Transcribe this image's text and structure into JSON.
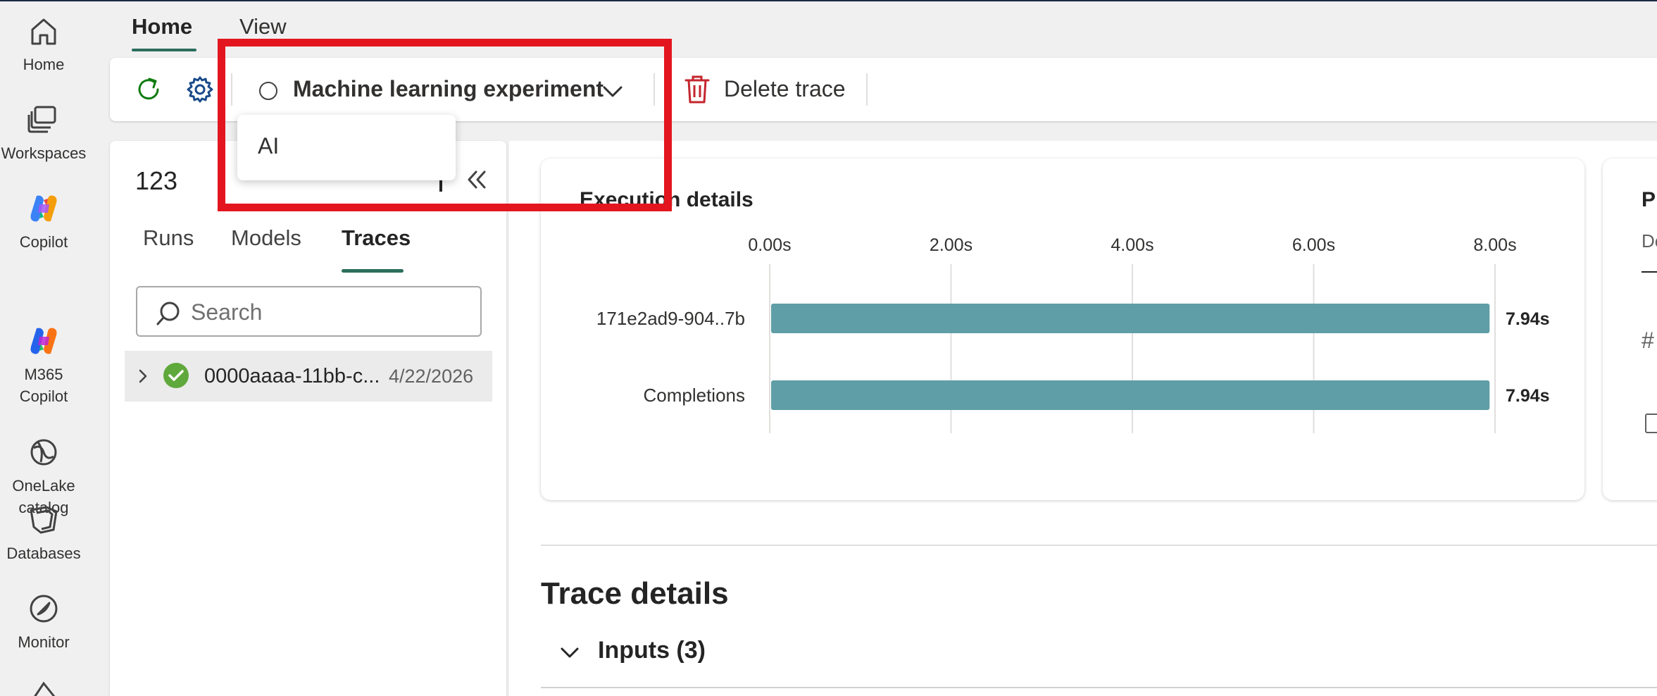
{
  "rail": {
    "items": [
      {
        "label": "Home",
        "icon": "home-icon"
      },
      {
        "label": "Workspaces",
        "icon": "workspaces-icon"
      },
      {
        "label": "Copilot",
        "icon": "copilot-icon"
      },
      {
        "label": "M365\nCopilot",
        "icon": "m365-copilot-icon"
      },
      {
        "label": "OneLake\ncatalog",
        "icon": "onelake-icon"
      },
      {
        "label": "Databases",
        "icon": "databases-icon"
      },
      {
        "label": "Monitor",
        "icon": "monitor-icon"
      }
    ]
  },
  "header": {
    "tabs": [
      {
        "label": "Home",
        "active": true
      },
      {
        "label": "View",
        "active": false
      }
    ]
  },
  "toolbar": {
    "experiment_label": "Machine learning experiment",
    "delete_label": "Delete trace"
  },
  "popup": {
    "items": [
      "AI"
    ]
  },
  "left_panel": {
    "title": "123",
    "tabs": [
      {
        "label": "Runs"
      },
      {
        "label": "Models"
      },
      {
        "label": "Traces",
        "active": true
      }
    ],
    "search_placeholder": "Search",
    "rows": [
      {
        "name": "0000aaaa-11bb-c...",
        "date": "4/22/2026",
        "status": "success"
      }
    ]
  },
  "execution": {
    "title": "Execution details"
  },
  "chart_data": {
    "type": "bar",
    "orientation": "horizontal",
    "title": "Execution details",
    "categories": [
      "171e2ad9-904..7b",
      "Completions"
    ],
    "values": [
      7.94,
      7.94
    ],
    "value_labels": [
      "7.94s",
      "7.94s"
    ],
    "xticks": [
      "0.00s",
      "2.00s",
      "4.00s",
      "6.00s",
      "8.00s"
    ],
    "xlim": [
      0,
      8
    ],
    "grid": true,
    "color": "#5f9ea6"
  },
  "second_card": {
    "title": "Pr",
    "subtitle": "De",
    "hash": "#"
  },
  "trace_details": {
    "title": "Trace details",
    "inputs_label": "Inputs (3)"
  },
  "colors": {
    "accent": "#2b6e5c",
    "highlight": "#e3161f",
    "bar": "#5f9ea6",
    "success": "#6aa84f"
  }
}
